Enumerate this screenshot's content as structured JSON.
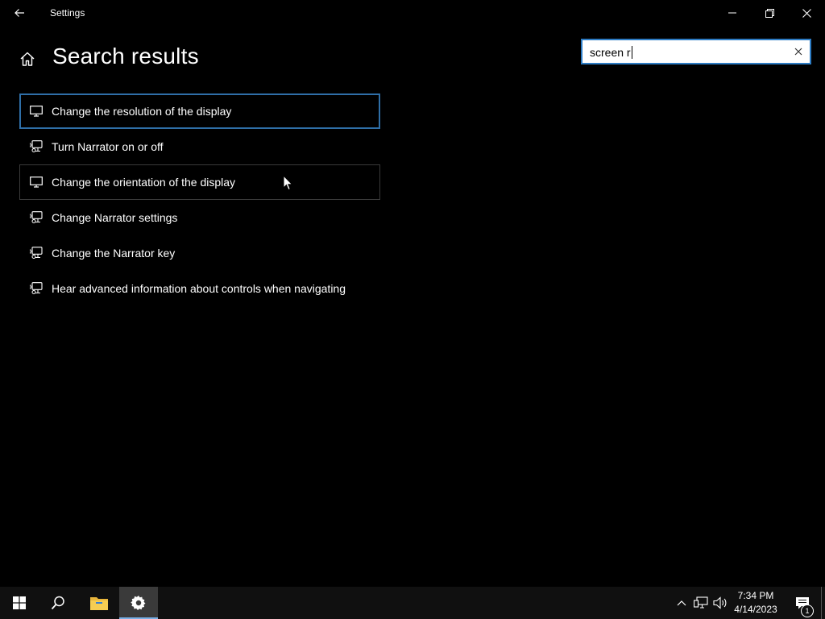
{
  "window": {
    "title": "Settings",
    "back_icon": "back-arrow-icon",
    "controls": [
      "minimize-icon",
      "restore-icon",
      "close-icon"
    ]
  },
  "header": {
    "home_icon": "home-icon",
    "title": "Search results"
  },
  "search": {
    "value": "screen r",
    "clear_icon": "clear-x-icon"
  },
  "results": [
    {
      "label": "Change the resolution of the display",
      "icon": "monitor-icon",
      "state": "focused"
    },
    {
      "label": "Turn Narrator on or off",
      "icon": "narrator-icon",
      "state": "normal"
    },
    {
      "label": "Change the orientation of the display",
      "icon": "monitor-icon",
      "state": "hovered"
    },
    {
      "label": "Change Narrator settings",
      "icon": "narrator-icon",
      "state": "normal"
    },
    {
      "label": "Change the Narrator key",
      "icon": "narrator-icon",
      "state": "normal"
    },
    {
      "label": "Hear advanced information about controls when navigating",
      "icon": "narrator-icon",
      "state": "normal"
    }
  ],
  "taskbar": {
    "start_icon": "windows-logo-icon",
    "search_icon": "search-icon",
    "explorer_icon": "file-explorer-icon",
    "settings_icon": "gear-icon",
    "tray": [
      "chevron-up-icon",
      "network-icon",
      "volume-icon"
    ],
    "time": "7:34 PM",
    "date": "4/14/2023",
    "notification_count": "1",
    "accent": "#7ab0e6"
  },
  "colors": {
    "background": "#000000",
    "focus_border": "#2f6fa8",
    "search_border": "#2d7cc4"
  }
}
